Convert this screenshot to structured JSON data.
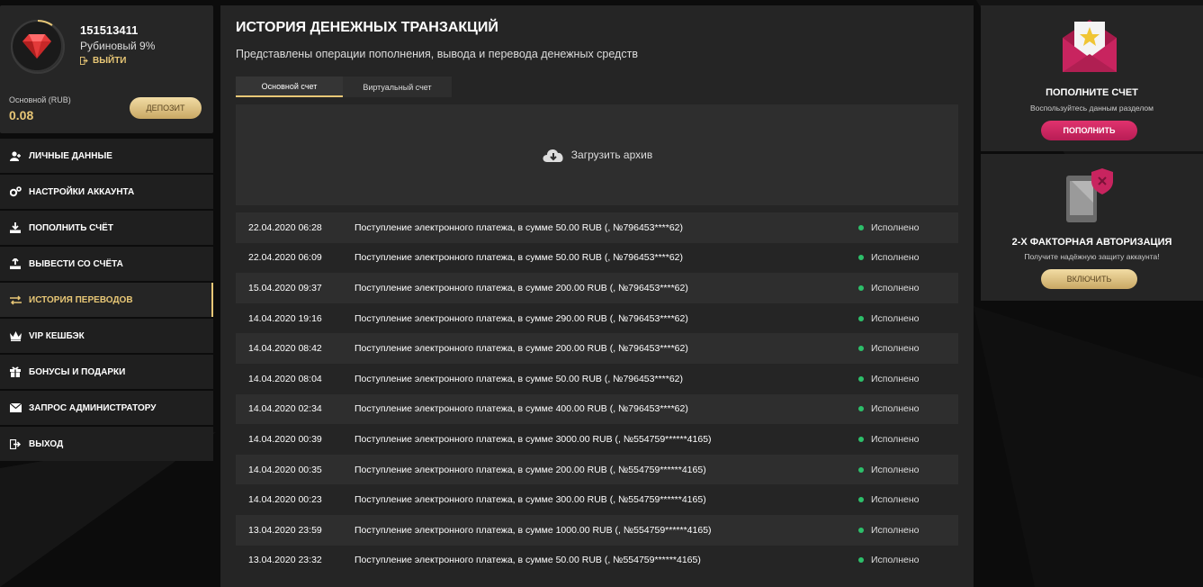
{
  "profile": {
    "user_id": "151513411",
    "level": "Рубиновый 9%",
    "logout_label": "ВЫЙТИ",
    "account_label": "Основной (RUB)",
    "balance": "0.08",
    "deposit_label": "ДЕПОЗИТ"
  },
  "menu": [
    {
      "label": "ЛИЧНЫЕ ДАННЫЕ",
      "icon": "user-plus-icon"
    },
    {
      "label": "НАСТРОЙКИ АККАУНТА",
      "icon": "gears-icon"
    },
    {
      "label": "ПОПОЛНИТЬ СЧЁТ",
      "icon": "download-icon"
    },
    {
      "label": "ВЫВЕСТИ СО СЧЁТА",
      "icon": "upload-icon"
    },
    {
      "label": "ИСТОРИЯ ПЕРЕВОДОВ",
      "icon": "transfer-arrows-icon"
    },
    {
      "label": "VIP КЕШБЭК",
      "icon": "crown-icon"
    },
    {
      "label": "БОНУСЫ И ПОДАРКИ",
      "icon": "gift-icon"
    },
    {
      "label": "ЗАПРОС АДМИНИСТРАТОРУ",
      "icon": "envelope-icon"
    },
    {
      "label": "ВЫХОД",
      "icon": "sign-out-icon"
    }
  ],
  "main": {
    "title": "ИСТОРИЯ ДЕНЕЖНЫХ ТРАНЗАКЦИЙ",
    "subtitle": "Представлены операции пополнения, вывода и перевода денежных средств",
    "tabs": [
      "Основной счет",
      "Виртуальный счет"
    ],
    "archive_label": "Загрузить архив",
    "transactions": [
      {
        "date": "22.04.2020 06:28",
        "desc": "Поступление электронного платежа, в сумме 50.00 RUB (, №796453****62)",
        "status": "Исполнено"
      },
      {
        "date": "22.04.2020 06:09",
        "desc": "Поступление электронного платежа, в сумме 50.00 RUB (, №796453****62)",
        "status": "Исполнено"
      },
      {
        "date": "15.04.2020 09:37",
        "desc": "Поступление электронного платежа, в сумме 200.00 RUB (, №796453****62)",
        "status": "Исполнено"
      },
      {
        "date": "14.04.2020 19:16",
        "desc": "Поступление электронного платежа, в сумме 290.00 RUB (, №796453****62)",
        "status": "Исполнено"
      },
      {
        "date": "14.04.2020 08:42",
        "desc": "Поступление электронного платежа, в сумме 200.00 RUB (, №796453****62)",
        "status": "Исполнено"
      },
      {
        "date": "14.04.2020 08:04",
        "desc": "Поступление электронного платежа, в сумме 50.00 RUB (, №796453****62)",
        "status": "Исполнено"
      },
      {
        "date": "14.04.2020 02:34",
        "desc": "Поступление электронного платежа, в сумме 400.00 RUB (, №796453****62)",
        "status": "Исполнено"
      },
      {
        "date": "14.04.2020 00:39",
        "desc": "Поступление электронного платежа, в сумме 3000.00 RUB (, №554759******4165)",
        "status": "Исполнено"
      },
      {
        "date": "14.04.2020 00:35",
        "desc": "Поступление электронного платежа, в сумме 200.00 RUB (, №554759******4165)",
        "status": "Исполнено"
      },
      {
        "date": "14.04.2020 00:23",
        "desc": "Поступление электронного платежа, в сумме 300.00 RUB (, №554759******4165)",
        "status": "Исполнено"
      },
      {
        "date": "13.04.2020 23:59",
        "desc": "Поступление электронного платежа, в сумме 1000.00 RUB (, №554759******4165)",
        "status": "Исполнено"
      },
      {
        "date": "13.04.2020 23:32",
        "desc": "Поступление электронного платежа, в сумме 50.00 RUB (, №554759******4165)",
        "status": "Исполнено"
      }
    ]
  },
  "right": {
    "deposit_title": "ПОПОЛНИТЕ СЧЕТ",
    "deposit_sub": "Воспользуйтесь данным разделом",
    "deposit_btn": "ПОПОЛНИТЬ",
    "twofa_title": "2-Х ФАКТОРНАЯ АВТОРИЗАЦИЯ",
    "twofa_sub": "Получите надёжную защиту аккаунта!",
    "twofa_btn": "ВКЛЮЧИТЬ"
  },
  "colors": {
    "accent_gold": "#e8c776",
    "accent_pink": "#c8245f",
    "status_green": "#2dbf6a"
  }
}
